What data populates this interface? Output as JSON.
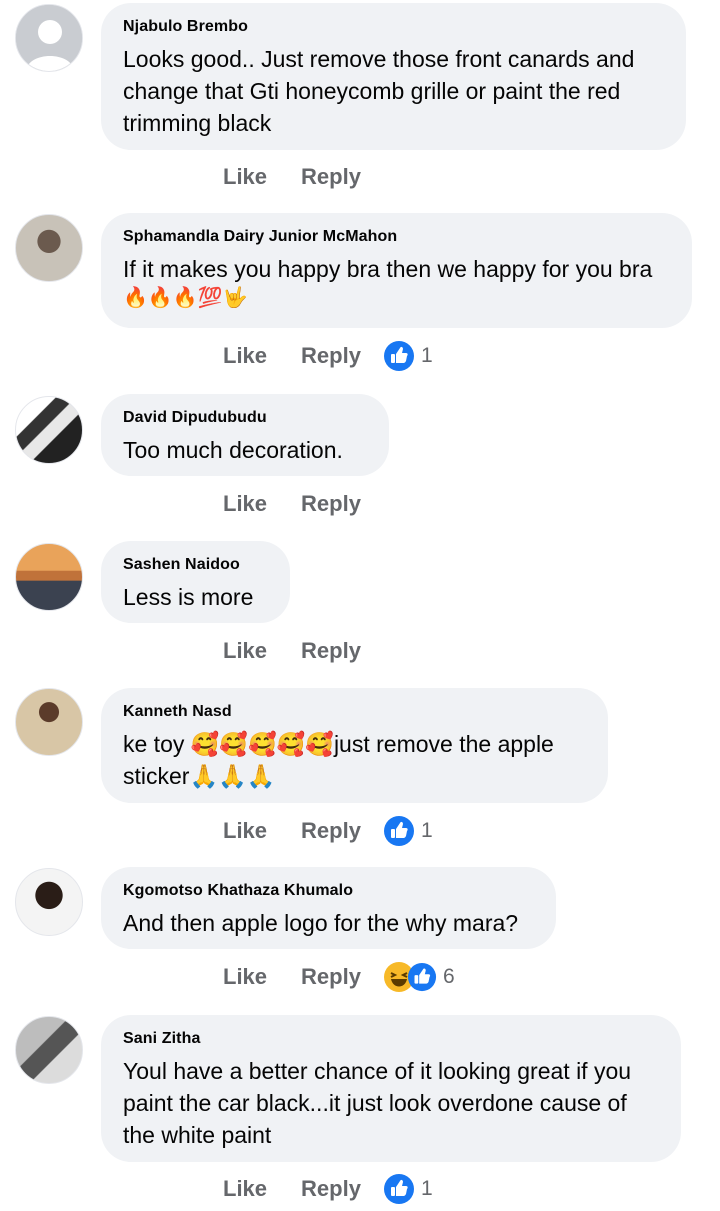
{
  "comments": [
    {
      "author": "Njabulo Brembo",
      "text": "Looks good.. Just remove those front canards and change that Gti honeycomb grille or paint the red trimming black",
      "like": "Like",
      "reply": "Reply",
      "reaction_count": ""
    },
    {
      "author": "Sphamandla Dairy Junior McMahon",
      "text": "If it makes you happy bra then we happy for you bra",
      "emoji": "🔥🔥🔥💯🤟",
      "like": "Like",
      "reply": "Reply",
      "reaction_count": "1"
    },
    {
      "author": "David Dipudubudu",
      "text": "Too much decoration.",
      "like": "Like",
      "reply": "Reply",
      "reaction_count": ""
    },
    {
      "author": "Sashen Naidoo",
      "text": "Less is more",
      "like": "Like",
      "reply": "Reply",
      "reaction_count": ""
    },
    {
      "author": "Kanneth Nasd",
      "text": "ke toy 🥰🥰🥰🥰🥰just remove the apple sticker🙏🙏🙏",
      "like": "Like",
      "reply": "Reply",
      "reaction_count": "1"
    },
    {
      "author": "Kgomotso Khathaza Khumalo",
      "text": "And then apple logo for the why mara?",
      "like": "Like",
      "reply": "Reply",
      "reaction_count": "6"
    },
    {
      "author": "Sani Zitha",
      "text": "Youl have a better chance of it looking great if you paint the car black...it just look overdone cause of the white paint",
      "like": "Like",
      "reply": "Reply",
      "reaction_count": "1"
    }
  ],
  "colors": {
    "like_blue": "#1877f2",
    "haha_yellow": "#f7b928",
    "bubble": "#f0f2f5",
    "action_gray": "#65676b"
  },
  "icons": {
    "like_reaction": "like-reaction-icon",
    "haha_reaction": "haha-reaction-icon",
    "default_avatar": "default-avatar-icon"
  }
}
